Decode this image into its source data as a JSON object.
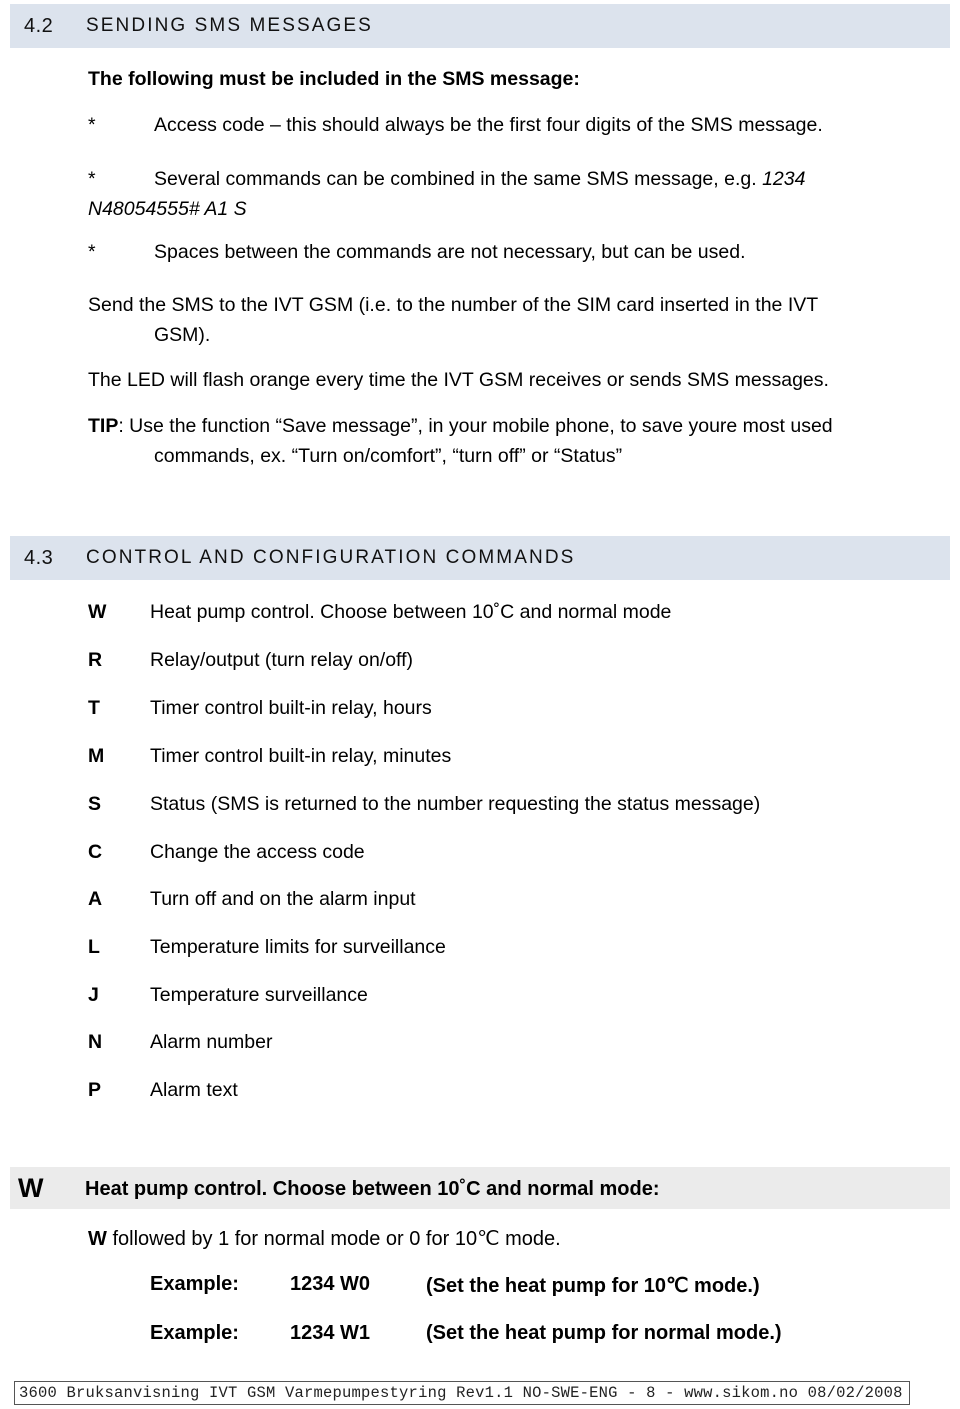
{
  "document": {
    "title": "IVT GSM Varmepumpestyring – Sending SMS messages"
  },
  "sections": [
    {
      "number": "4.2",
      "title": "SENDING SMS MESSAGES"
    },
    {
      "number": "4.3",
      "title": "CONTROL AND CONFIGURATION COMMANDS"
    }
  ],
  "intro": {
    "lead": "The following must be included in the SMS message:",
    "bullets": [
      {
        "marker": "*",
        "text": "Access code – this should always be the first four digits of the SMS message."
      },
      {
        "marker": "*",
        "text_plain": "Several commands can be combined in the same SMS message, e.g. ",
        "text_italic": "1234",
        "continuation_italic": "N48054555# A1 S"
      },
      {
        "marker": "*",
        "text": "Spaces between the commands are not necessary, but can be used."
      }
    ],
    "paragraphs": [
      {
        "line1": "Send the SMS to the IVT GSM (i.e. to the number of the SIM card inserted in the IVT",
        "line2": "GSM)."
      },
      {
        "line1": "The LED will flash orange every time the IVT GSM receives or sends SMS messages."
      }
    ],
    "tip": {
      "label": "TIP",
      "line1": ": Use the function “Save message”, in your mobile phone, to save youre most used",
      "line2": "commands, ex. “Turn on/comfort”, “turn off” or “Status”"
    }
  },
  "commands": [
    {
      "key": "W",
      "description": "Heat pump control. Choose between 10˚C and normal mode"
    },
    {
      "key": "R",
      "description": "Relay/output (turn relay on/off)"
    },
    {
      "key": "T",
      "description": "Timer control built-in relay, hours"
    },
    {
      "key": "M",
      "description": "Timer control built-in relay, minutes"
    },
    {
      "key": "S",
      "description": "Status (SMS is returned to the number requesting the status message)"
    },
    {
      "key": "C",
      "description": "Change the access code"
    },
    {
      "key": "A",
      "description": "Turn off and on the alarm input"
    },
    {
      "key": "L",
      "description": "Temperature limits for surveillance"
    },
    {
      "key": "J",
      "description": "Temperature surveillance"
    },
    {
      "key": "N",
      "description": "Alarm number"
    },
    {
      "key": "P",
      "description": "Alarm text"
    }
  ],
  "w_detail": {
    "key": "W",
    "heading": "Heat pump control. Choose between 10˚C and normal mode:",
    "description_bold": "W",
    "description_rest": " followed by 1 for normal mode or 0 for 10℃ mode.",
    "examples": [
      {
        "label": "Example:",
        "code": "1234 W0",
        "note": "(Set the heat pump for 10℃ mode.)"
      },
      {
        "label": "Example:",
        "code": "1234 W1",
        "note": "(Set the heat pump for normal mode.)"
      }
    ]
  },
  "footer": {
    "text": "3600 Bruksanvisning IVT GSM Varmepumpestyring Rev1.1 NO-SWE-ENG  - 8 -  www.sikom.no 08/02/2008"
  },
  "colors": {
    "section_band": "#dce3ed",
    "w_band": "#ebebeb",
    "text": "#000000"
  }
}
